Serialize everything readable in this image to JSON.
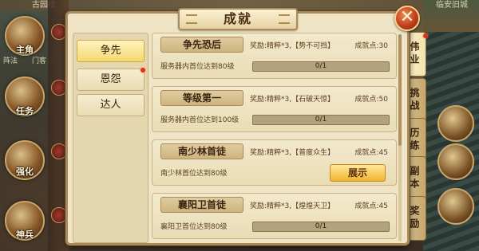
{
  "background": {
    "top_labels": [
      "古园楼",
      "临安旧城"
    ],
    "left_buttons": [
      "主角",
      "任务",
      "强化",
      "神兵"
    ],
    "left_partial_labels": [
      "阵法",
      "门客"
    ]
  },
  "panel": {
    "title": "成就",
    "close_label": "✕",
    "categories": [
      {
        "label": "争先",
        "active": true
      },
      {
        "label": "恩怨",
        "active": false
      },
      {
        "label": "达人",
        "active": false
      }
    ],
    "side_tabs": [
      {
        "label": "伟业",
        "active": true
      },
      {
        "label": "挑战",
        "active": false
      },
      {
        "label": "历练",
        "active": false
      },
      {
        "label": "副本",
        "active": false
      },
      {
        "label": "奖励",
        "active": false
      }
    ],
    "achievements": [
      {
        "name": "争先恐后",
        "reward": "奖励:精粹*3,【势不可挡】",
        "points": "成就点:30",
        "desc": "服务器内首位达到80级",
        "progress_text": "0/1",
        "progress": 0,
        "completed": false
      },
      {
        "name": "等级第一",
        "reward": "奖励:精粹*3,【石破天惊】",
        "points": "成就点:50",
        "desc": "服务器内首位达到100级",
        "progress_text": "0/1",
        "progress": 0,
        "completed": false
      },
      {
        "name": "南少林首徒",
        "reward": "奖励:精粹*3,【普度众生】",
        "points": "成就点:45",
        "desc": "南少林首位达到80级",
        "button": "展示",
        "completed": true
      },
      {
        "name": "襄阳卫首徒",
        "reward": "奖励:精粹*3,【煌煌天卫】",
        "points": "成就点:45",
        "desc": "襄阳卫首位达到80级",
        "progress_text": "0/1",
        "progress": 0,
        "completed": false
      }
    ]
  }
}
